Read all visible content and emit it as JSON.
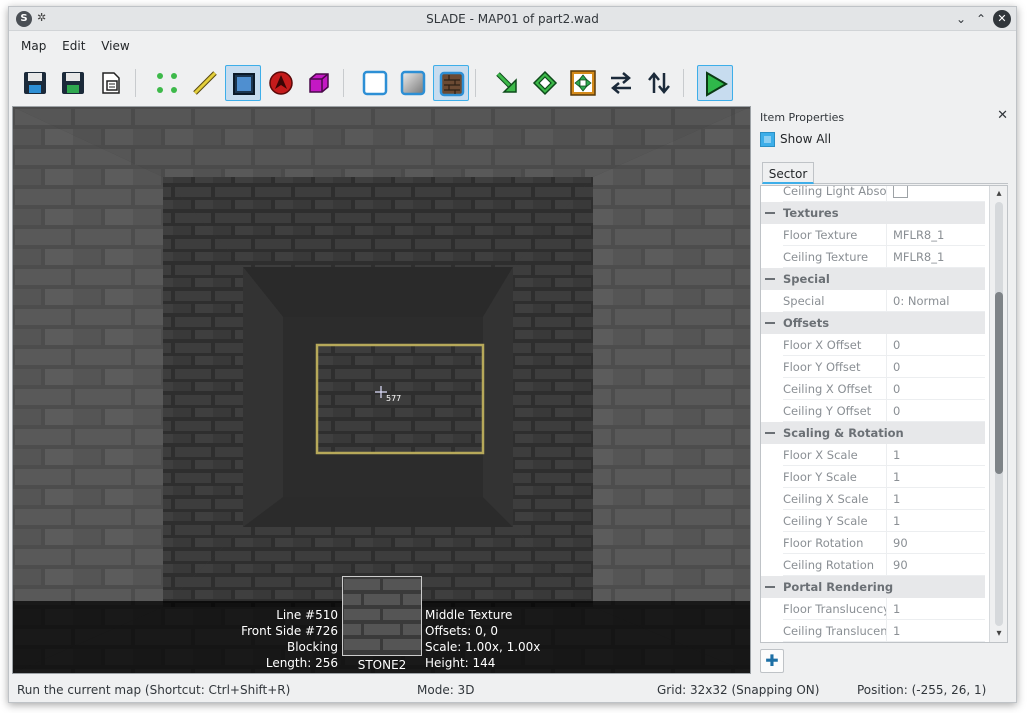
{
  "window": {
    "title": "SLADE - MAP01 of part2.wad",
    "app_icon": "slade-icon",
    "pin_icon": "pin-icon",
    "controls": [
      "chevron-down-icon",
      "chevron-up-icon",
      "close-icon"
    ]
  },
  "menu": {
    "items": [
      "Map",
      "Edit",
      "View"
    ]
  },
  "toolbar": {
    "buttons": [
      {
        "icon": "save-icon",
        "active": false
      },
      {
        "icon": "save-as-icon",
        "active": false
      },
      {
        "icon": "save-copy-icon",
        "active": false
      },
      {
        "icon": "vertices-mode-icon",
        "active": false
      },
      {
        "icon": "lines-mode-icon",
        "active": false
      },
      {
        "icon": "sectors-mode-icon",
        "active": true
      },
      {
        "icon": "things-mode-icon",
        "active": false
      },
      {
        "icon": "3d-mode-icon",
        "active": false
      },
      {
        "icon": "flat-none-icon",
        "active": false
      },
      {
        "icon": "flat-untextured-icon",
        "active": false
      },
      {
        "icon": "flat-textured-icon",
        "active": true
      },
      {
        "icon": "arrow-down-right-icon",
        "active": false
      },
      {
        "icon": "diamond-icon",
        "active": false
      },
      {
        "icon": "grid-move-icon",
        "active": false
      },
      {
        "icon": "swap-horizontal-icon",
        "active": false
      },
      {
        "icon": "swap-vertical-icon",
        "active": false
      },
      {
        "icon": "play-icon",
        "active": true
      }
    ]
  },
  "viewport": {
    "crosshair_label": "577",
    "info": {
      "left": [
        "Line #510",
        "Front Side #726",
        "Blocking",
        "Length: 256"
      ],
      "right": [
        "Middle Texture",
        "Offsets: 0, 0",
        "Scale: 1.00x, 1.00x",
        "Height: 144"
      ],
      "texture_name": "STONE2"
    }
  },
  "panel": {
    "title": "Item Properties",
    "show_all_label": "Show All",
    "show_all_checked": true,
    "tab": "Sector",
    "rows": [
      {
        "type": "prop",
        "name": "Ceiling Light Absolu",
        "checkbox": true,
        "value": ""
      },
      {
        "type": "cat",
        "name": "Textures"
      },
      {
        "type": "prop",
        "name": "Floor Texture",
        "value": "MFLR8_1"
      },
      {
        "type": "prop",
        "name": "Ceiling Texture",
        "value": "MFLR8_1"
      },
      {
        "type": "cat",
        "name": "Special"
      },
      {
        "type": "prop",
        "name": "Special",
        "value": "0: Normal"
      },
      {
        "type": "cat",
        "name": "Offsets"
      },
      {
        "type": "prop",
        "name": "Floor X Offset",
        "value": "0"
      },
      {
        "type": "prop",
        "name": "Floor Y Offset",
        "value": "0"
      },
      {
        "type": "prop",
        "name": "Ceiling X Offset",
        "value": "0"
      },
      {
        "type": "prop",
        "name": "Ceiling Y Offset",
        "value": "0"
      },
      {
        "type": "cat",
        "name": "Scaling & Rotation"
      },
      {
        "type": "prop",
        "name": "Floor X Scale",
        "value": "1"
      },
      {
        "type": "prop",
        "name": "Floor Y Scale",
        "value": "1"
      },
      {
        "type": "prop",
        "name": "Ceiling X Scale",
        "value": "1"
      },
      {
        "type": "prop",
        "name": "Ceiling Y Scale",
        "value": "1"
      },
      {
        "type": "prop",
        "name": "Floor Rotation",
        "value": "90"
      },
      {
        "type": "prop",
        "name": "Ceiling Rotation",
        "value": "90"
      },
      {
        "type": "cat",
        "name": "Portal Rendering"
      },
      {
        "type": "prop",
        "name": "Floor Translucency",
        "value": "1"
      },
      {
        "type": "prop",
        "name": "Ceiling Translucency",
        "value": "1"
      }
    ],
    "add_button_icon": "plus-icon"
  },
  "statusbar": {
    "message": "Run the current map (Shortcut: Ctrl+Shift+R)",
    "mode": "Mode: 3D",
    "grid": "Grid: 32x32 (Snapping ON)",
    "position": "Position: (-255, 26, 1)"
  },
  "colors": {
    "accent": "#3daee9",
    "selection_outline": "#b7a95a",
    "window_bg": "#eff0f1"
  }
}
